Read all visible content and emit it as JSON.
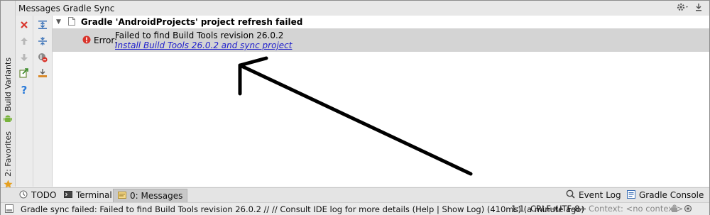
{
  "panel": {
    "title": "Messages Gradle Sync",
    "settings_icon": "gear-icon",
    "hide_icon": "hide-panel-icon"
  },
  "side_tabs": {
    "build_variants": "Build Variants",
    "favorites": "2: Favorites"
  },
  "messages": {
    "group_title": "Gradle 'AndroidProjects' project refresh failed",
    "error_label": "Error:",
    "error_text": "Failed to find Build Tools revision 26.0.2",
    "error_link": "Install Build Tools 26.0.2 and sync project"
  },
  "bottom_tabs": {
    "todo": "TODO",
    "terminal": "Terminal",
    "messages": "0: Messages",
    "event_log": "Event Log",
    "gradle_console": "Gradle Console"
  },
  "status": {
    "message": "Gradle sync failed: Failed to find Build Tools revision 26.0.2 // // Consult IDE log for more details (Help | Show Log) (410ms) (a minute ago)",
    "position": "1:1",
    "line_sep": "CRLF÷",
    "encoding": "UTF-8÷",
    "context": "Context: <no context>"
  },
  "colors": {
    "error_red": "#d9342b",
    "link_blue": "#2020cc",
    "selection_gray": "#d4d4d4"
  }
}
